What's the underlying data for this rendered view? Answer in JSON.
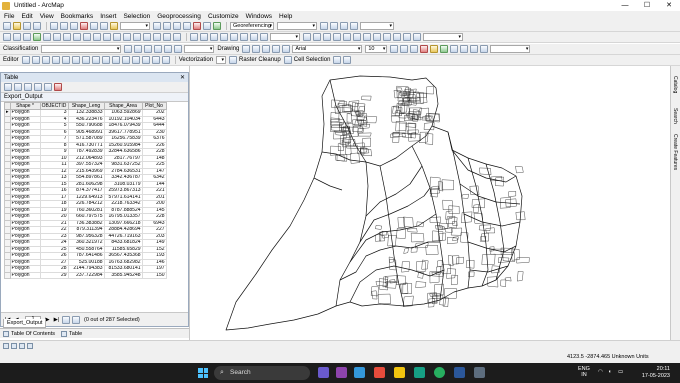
{
  "window": {
    "title": "Untitled - ArcMap",
    "controls": [
      "—",
      "☐",
      "✕"
    ]
  },
  "menu": [
    "File",
    "Edit",
    "View",
    "Bookmarks",
    "Insert",
    "Selection",
    "Geoprocessing",
    "Customize",
    "Windows",
    "Help"
  ],
  "toolbar": {
    "georeferencing_label": "Georeferencing",
    "classification_label": "Classification",
    "drawing_label": "Drawing",
    "font_name": "Arial",
    "font_size": "10",
    "editor_label": "Editor",
    "vectorization_label": "Vectorization",
    "raster_cleanup_label": "Raster Cleanup",
    "cell_selection_label": "Cell Selection"
  },
  "table": {
    "window_title": "Table",
    "layer_name": "Export_Output",
    "columns": [
      "Shape *",
      "OBJECTID",
      "Shape_Leng",
      "Shape_Area",
      "Plot_No"
    ],
    "rows": [
      [
        "Polygon",
        "3",
        "132.338833",
        "1063.592869",
        "202"
      ],
      [
        "Polygon",
        "4",
        "436.223476",
        "10192.104034",
        "6443"
      ],
      [
        "Polygon",
        "5",
        "550.790688",
        "18476.079439",
        "6444"
      ],
      [
        "Polygon",
        "6",
        "905.468991",
        "39617.778951",
        "230"
      ],
      [
        "Polygon",
        "7",
        "571.587089",
        "16256.75839",
        "6376"
      ],
      [
        "Polygon",
        "8",
        "416.730771",
        "15260.915984",
        "226"
      ],
      [
        "Polygon",
        "9",
        "787.492839",
        "32844.636586",
        "228"
      ],
      [
        "Polygon",
        "10",
        "212.064893",
        "2817.76797",
        "148"
      ],
      [
        "Polygon",
        "11",
        "397.557324",
        "9831.637252",
        "225"
      ],
      [
        "Polygon",
        "12",
        "215.643969",
        "2784.636531",
        "147"
      ],
      [
        "Polygon",
        "13",
        "554.897861",
        "3342.436787",
        "6342"
      ],
      [
        "Polygon",
        "15",
        "281.606298",
        "3108.03179",
        "144"
      ],
      [
        "Polygon",
        "16",
        "874.377417",
        "25973.867313",
        "221"
      ],
      [
        "Polygon",
        "17",
        "1229.64913",
        "57971.614141",
        "201"
      ],
      [
        "Polygon",
        "18",
        "226.784212",
        "2218.763342",
        "200"
      ],
      [
        "Polygon",
        "19",
        "760.360281",
        "8787.888524",
        "145"
      ],
      [
        "Polygon",
        "20",
        "660.797575",
        "16795.013357",
        "228"
      ],
      [
        "Polygon",
        "21",
        "736.383882",
        "13097.666218",
        "6943"
      ],
      [
        "Polygon",
        "22",
        "879.311394",
        "28884.428694",
        "227"
      ],
      [
        "Polygon",
        "23",
        "987.956328",
        "44726.719163",
        "203"
      ],
      [
        "Polygon",
        "24",
        "360.321972",
        "8433.681824",
        "149"
      ],
      [
        "Polygon",
        "25",
        "450.558764",
        "11585.65829",
        "152"
      ],
      [
        "Polygon",
        "26",
        "787.641486",
        "36567.435368",
        "193"
      ],
      [
        "Polygon",
        "27",
        "525.00188",
        "16763.682982",
        "146"
      ],
      [
        "Polygon",
        "28",
        "2144.794383",
        "81533.680141",
        "197"
      ],
      [
        "Polygon",
        "29",
        "237.722984",
        "3585.945248",
        "150"
      ]
    ],
    "page_number": "1",
    "selection_status": "(0 out of 287 Selected)",
    "tab_label": "Export_Output",
    "bottom_tabs": [
      "Table Of Contents",
      "Table"
    ]
  },
  "side_tabs": [
    "Catalog",
    "Search",
    "Create Features"
  ],
  "status": {
    "coordinates": "4123.5  -2874.465 Unknown Units"
  },
  "taskbar": {
    "search_placeholder": "Search",
    "language": [
      "ENG",
      "IN"
    ],
    "time": "20:11",
    "date": "17-05-2023"
  }
}
